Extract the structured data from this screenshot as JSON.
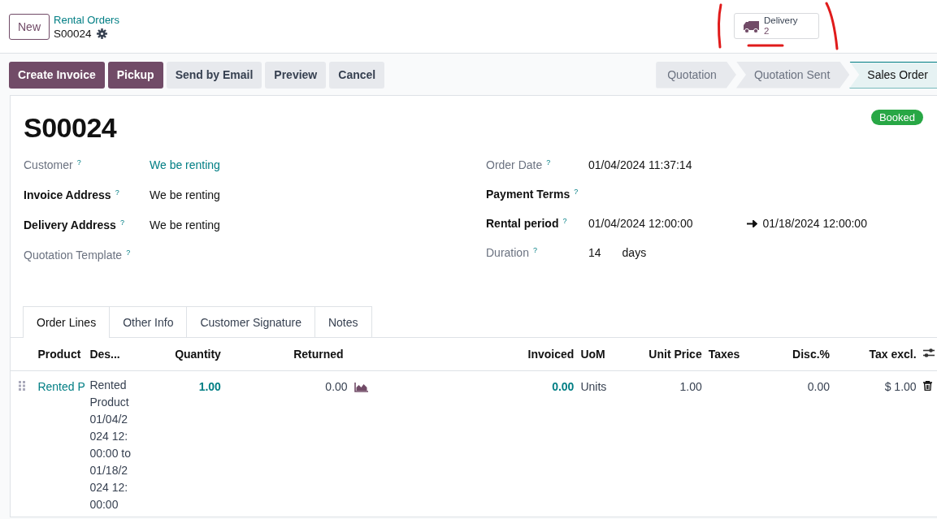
{
  "control_panel": {
    "new_button": "New",
    "breadcrumb": "Rental Orders",
    "record": "S00024",
    "smart_button": {
      "label": "Delivery",
      "count": "2"
    }
  },
  "actions": [
    {
      "label": "Create Invoice",
      "primary": true
    },
    {
      "label": "Pickup",
      "primary": true
    },
    {
      "label": "Send by Email",
      "primary": false
    },
    {
      "label": "Preview",
      "primary": false
    },
    {
      "label": "Cancel",
      "primary": false
    }
  ],
  "statuses": [
    {
      "label": "Quotation",
      "selected": false
    },
    {
      "label": "Quotation Sent",
      "selected": false
    },
    {
      "label": "Sales Order",
      "selected": true
    }
  ],
  "form": {
    "title": "S00024",
    "badge": "Booked",
    "left_fields": [
      {
        "label": "Customer",
        "help": "?",
        "required": false,
        "value": "We be renting",
        "link": true
      },
      {
        "label": "Invoice Address",
        "help": "?",
        "required": true,
        "value": "We be renting",
        "link": false
      },
      {
        "label": "Delivery Address",
        "help": "?",
        "required": true,
        "value": "We be renting",
        "link": false
      },
      {
        "label": "Quotation Template",
        "help": "?",
        "required": false
      }
    ],
    "right_fields": [
      {
        "label": "Order Date",
        "help": "?",
        "required": false,
        "value": "01/04/2024 11:37:14"
      },
      {
        "label": "Payment Terms",
        "help": "?",
        "required": true
      },
      {
        "label": "Rental period",
        "help": "?",
        "required": true,
        "value": "01/04/2024 12:00:00",
        "end": "01/18/2024 12:00:00"
      },
      {
        "label": "Duration",
        "help": "?",
        "required": false,
        "value": "14",
        "unit": "days"
      }
    ]
  },
  "tabs": [
    {
      "label": "Order Lines",
      "selected": true
    },
    {
      "label": "Other Info",
      "selected": false
    },
    {
      "label": "Customer Signature",
      "selected": false
    },
    {
      "label": "Notes",
      "selected": false
    }
  ],
  "table": {
    "columns": [
      "Product",
      "Des...",
      "Quantity",
      "Returned",
      "Invoiced",
      "UoM",
      "Unit Price",
      "Taxes",
      "Disc.%",
      "Tax excl."
    ],
    "rows": [
      {
        "product": "Rented P",
        "description": "Rented Product 01/04/2024 12:00:00 to 01/18/2024 12:00:00",
        "quantity": "1.00",
        "returned": "0.00",
        "invoiced": "0.00",
        "uom": "Units",
        "unit_price": "1.00",
        "disc": "0.00",
        "subtotal": "$ 1.00"
      }
    ]
  }
}
